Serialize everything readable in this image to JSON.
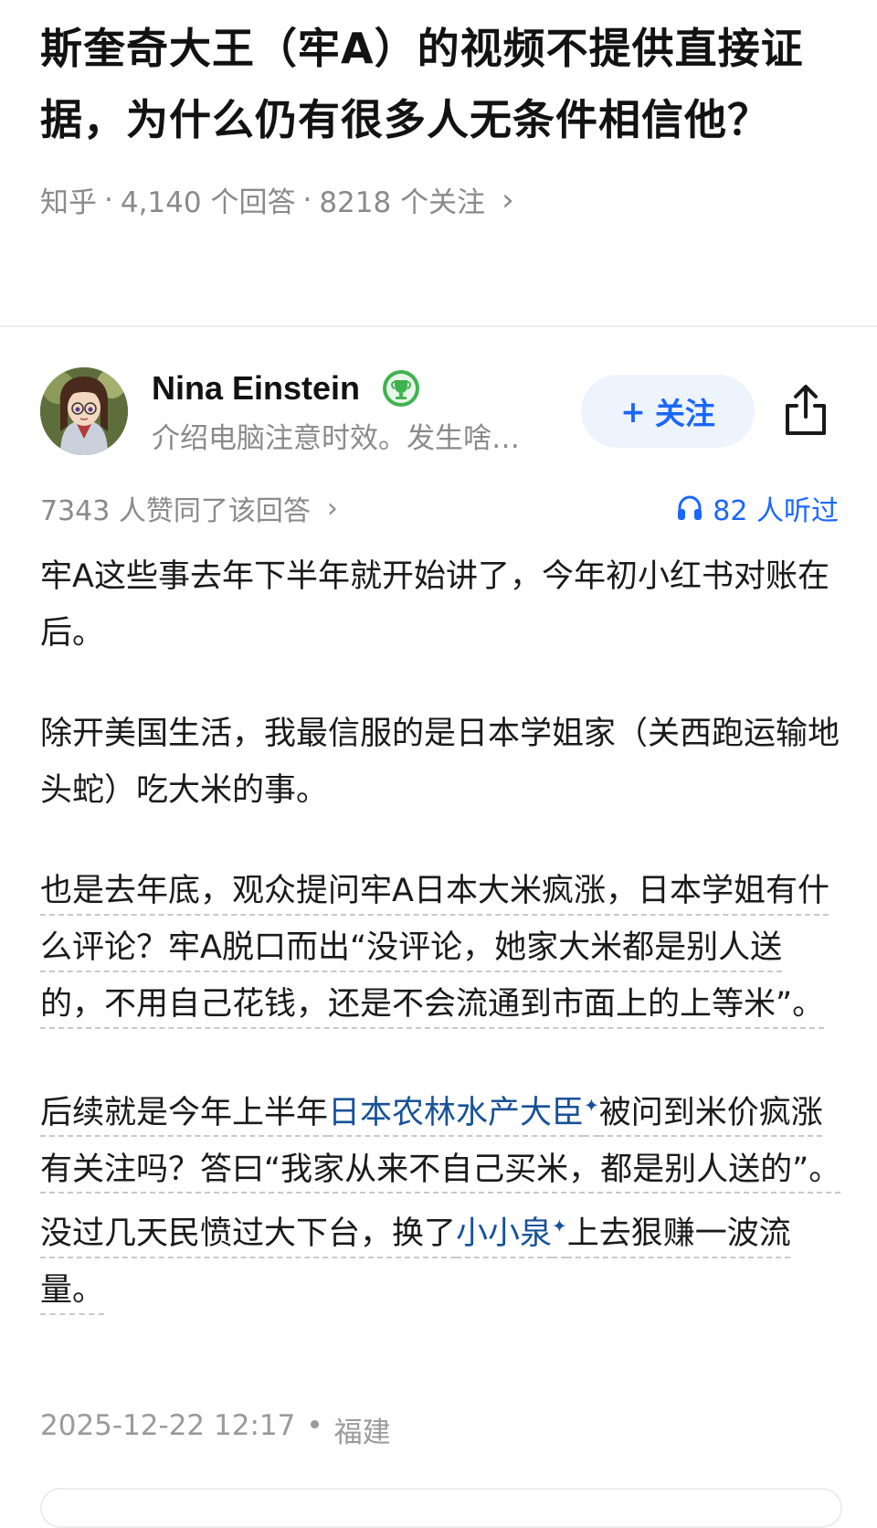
{
  "question": {
    "title": "斯奎奇大王（牢A）的视频不提供直接证据，为什么仍有很多人无条件相信他？",
    "source": "知乎",
    "sep": "·",
    "answers": "4,140 个回答",
    "followers": "8218 个关注",
    "chevron": "›"
  },
  "author": {
    "name": "Nina Einstein",
    "bio": "介绍电脑注意时效。发生啥…",
    "follow_label": "关注",
    "follow_plus": "+"
  },
  "stats": {
    "likes": "7343 人赞同了该回答",
    "chevron": "›",
    "listens": "82 人听过"
  },
  "content": {
    "p1": "牢A这些事去年下半年就开始讲了，今年初小红书对账在后。",
    "p2": "除开美国生活，我最信服的是日本学姐家（关西跑运输地头蛇）吃大米的事。",
    "p3": "也是去年底，观众提问牢A日本大米疯涨，日本学姐有什么评论？牢A脱口而出“没评论，她家大米都是别人送的，不用自己花钱，还是不会流通到市面上的上等米”。",
    "p4_a": "后续就是今年上半年",
    "p4_link1": "日本农林水产大臣",
    "p4_b": "被问到米价疯涨有关注吗？答曰“我家从来不自己买米，都是别人送的”。没过几天民愤过大下台，换了",
    "p4_link2": "小小泉",
    "p4_c": "上去狠赚一波流量。",
    "spark": "✦"
  },
  "meta": {
    "date": "2025-12-22 12:17",
    "dot": "•",
    "location": "福建"
  },
  "colors": {
    "accent": "#1a66ff",
    "link": "#175199",
    "muted": "#8a8a8a",
    "badge": "#4caf50"
  }
}
